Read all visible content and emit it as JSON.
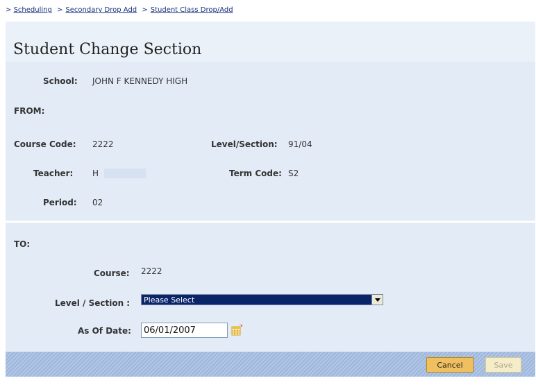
{
  "breadcrumb": {
    "prefix": ">",
    "items": [
      "Scheduling",
      "Secondary Drop Add",
      "Student Class Drop/Add"
    ],
    "separator": ">"
  },
  "page_title": "Student Change Section",
  "from_section": {
    "school_label": "School:",
    "school_value": "JOHN F KENNEDY HIGH",
    "heading": "FROM:",
    "course_code_label": "Course Code:",
    "course_code_value": "2222",
    "level_section_label": "Level/Section:",
    "level_section_value": "91/04",
    "teacher_label": "Teacher:",
    "teacher_value": "H",
    "term_code_label": "Term Code:",
    "term_code_value": "S2",
    "period_label": "Period:",
    "period_value": "02"
  },
  "to_section": {
    "heading": "TO:",
    "course_label": "Course:",
    "course_value": "2222",
    "level_section_label": "Level / Section :",
    "level_section_selected": "Please Select",
    "as_of_date_label": "As Of Date:",
    "as_of_date_value": "06/01/2007"
  },
  "buttons": {
    "cancel": "Cancel",
    "save": "Save"
  },
  "colors": {
    "panel_bg": "#e3ebf6",
    "footer_bg": "#9fb8de",
    "link": "#1a2f7a",
    "cancel_button": "#f0c060",
    "select_highlight": "#0a246a"
  }
}
